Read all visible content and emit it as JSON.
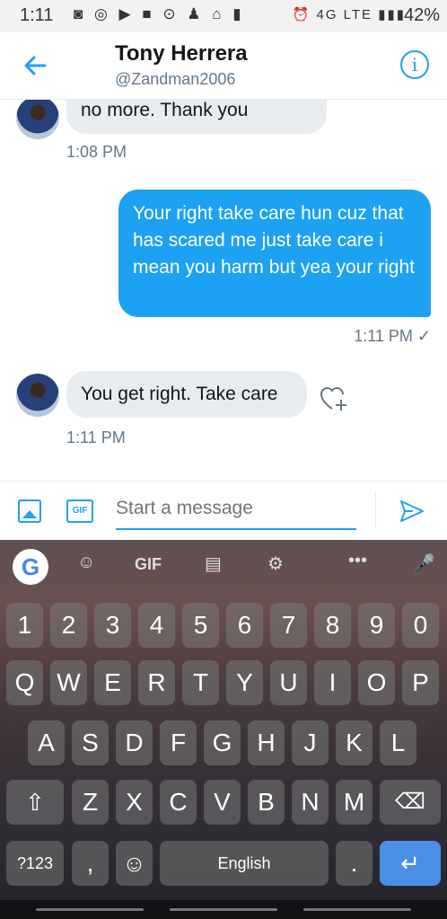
{
  "status": {
    "time": "1:11",
    "left_icons": "◙ ◎ ▶ ■ ⊙ ♟ ⌂ ▮",
    "right_icons": "⏰ 4G LTE ▮▮▮",
    "battery": "42%"
  },
  "header": {
    "name": "Tony Herrera",
    "handle": "@Zandman2006"
  },
  "messages": [
    {
      "dir": "in",
      "text": "no more. Thank you",
      "time": "1:08 PM"
    },
    {
      "dir": "out",
      "text": "Your right take care hun cuz that has scared me just take care i mean you harm but yea your right",
      "time": "1:11 PM ✓"
    },
    {
      "dir": "in",
      "text": "You get right. Take care",
      "time": "1:11 PM"
    }
  ],
  "composer": {
    "placeholder": "Start a message",
    "gif_label": "GIF"
  },
  "keyboard": {
    "top": {
      "gif": "GIF",
      "dots": "•••"
    },
    "row_numbers": [
      "1",
      "2",
      "3",
      "4",
      "5",
      "6",
      "7",
      "8",
      "9",
      "0"
    ],
    "row1": [
      "Q",
      "W",
      "E",
      "R",
      "T",
      "Y",
      "U",
      "I",
      "O",
      "P"
    ],
    "row2": [
      "A",
      "S",
      "D",
      "F",
      "G",
      "H",
      "J",
      "K",
      "L"
    ],
    "row3": [
      "Z",
      "X",
      "C",
      "V",
      "B",
      "N",
      "M"
    ],
    "symbols": "?123",
    "comma": ",",
    "space": "English",
    "period": "."
  },
  "colors": {
    "accent": "#1da1f2",
    "bubble_in": "#e6ecf0"
  }
}
